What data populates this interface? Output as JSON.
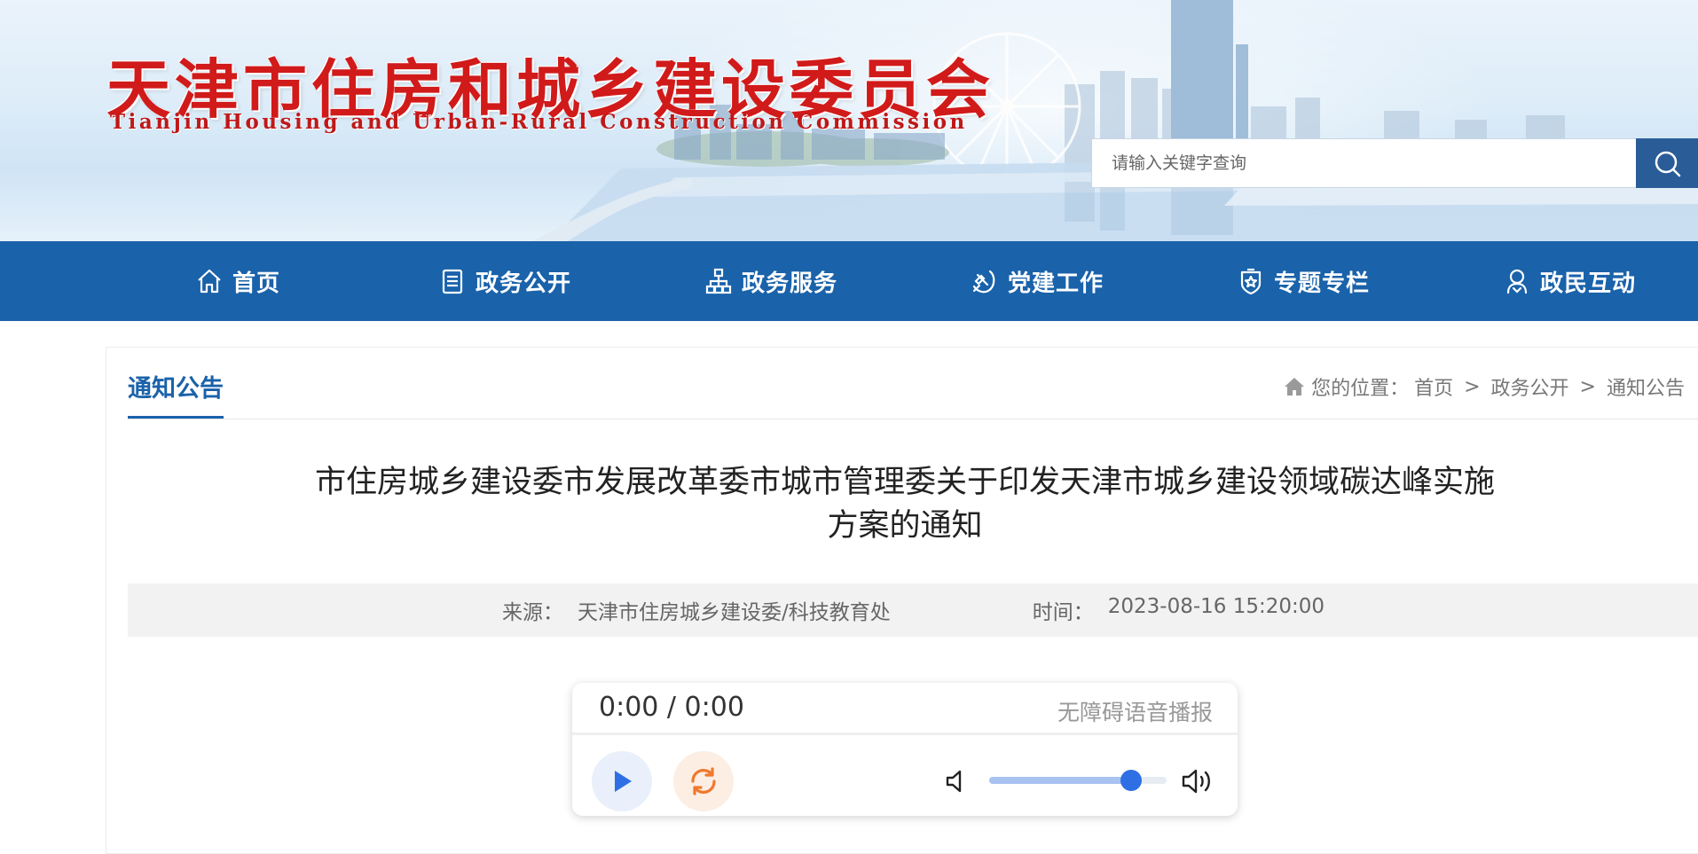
{
  "header": {
    "logo_cn": "天津市住房和城乡建设委员会",
    "logo_en": "Tianjin Housing and Urban-Rural Construction Commission",
    "search": {
      "placeholder": "请输入关键字查询",
      "value": ""
    }
  },
  "nav": {
    "items": [
      {
        "label": "首页",
        "icon": "home-icon"
      },
      {
        "label": "政务公开",
        "icon": "document-icon"
      },
      {
        "label": "政务服务",
        "icon": "org-chart-icon"
      },
      {
        "label": "党建工作",
        "icon": "party-emblem-icon"
      },
      {
        "label": "专题专栏",
        "icon": "star-shield-icon"
      },
      {
        "label": "政民互动",
        "icon": "user-icon"
      }
    ]
  },
  "content": {
    "section_title": "通知公告",
    "breadcrumb": {
      "prefix": "您的位置：",
      "items": [
        "首页",
        "政务公开",
        "通知公告"
      ],
      "separator": ">"
    },
    "article": {
      "title_line1": "市住房城乡建设委市发展改革委市城市管理委关于印发天津市城乡建设领域碳达峰实施",
      "title_line2": "方案的通知",
      "source_label": "来源：",
      "source_value": "天津市住房城乡建设委/科技教育处",
      "time_label": "时间：",
      "time_value": "2023-08-16 15:20:00"
    }
  },
  "audio_player": {
    "time": "0:00 / 0:00",
    "label": "无障碍语音播报",
    "volume": 0.8
  },
  "colors": {
    "nav_bg": "#1a62aa",
    "accent": "#1a62aa",
    "logo_red": "#d11a1a",
    "search_button": "#2a5d97",
    "volume_knob": "#2f6fe4"
  }
}
